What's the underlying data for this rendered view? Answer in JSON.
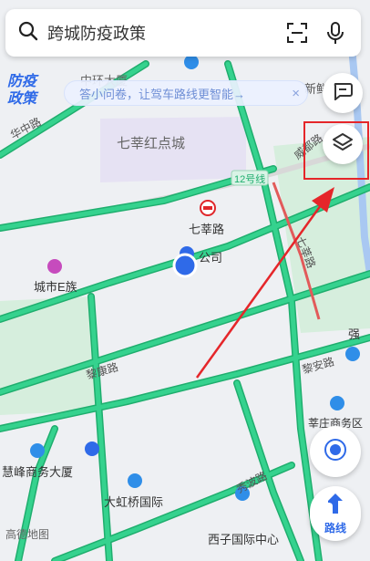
{
  "search": {
    "text": "跨城防疫政策"
  },
  "banner": {
    "text": "答小问卷，让驾车路线更智能→",
    "close": "×"
  },
  "epidemic_logo": {
    "line1": "防疫",
    "line2": "政策"
  },
  "map_labels": {
    "district": "七莘红点城",
    "metro_line": "12号线",
    "metro_station": "七莘路",
    "company": "公司",
    "hotel": "城市E族",
    "road_huazhong": "华中路",
    "road_weidu": "威都路",
    "road_qixin": "七莘路",
    "road_likang": "黎康路",
    "road_jingan": "黎安路",
    "road_xiubo": "秀波路",
    "poi_qiang": "强",
    "poi_xinbei": "莘庄商务区",
    "poi_huifeng": "慧峰商务大厦",
    "poi_dahongqiao": "大虹桥国际",
    "poi_xizi": "西子国际中心",
    "poi_top_left": "中环大厦",
    "poi_top_right": "新鲜"
  },
  "controls": {
    "route_label": "路线"
  },
  "brand": "高德地图",
  "colors": {
    "road": "#35d28e",
    "road_edge": "#1fae6e",
    "accent": "#2f6ae8",
    "highlight": "#e5262a"
  },
  "icons": {
    "search": "search-icon",
    "scan": "scan-icon",
    "mic": "mic-icon",
    "message": "message-icon",
    "layers": "layers-icon",
    "locate": "locate-icon",
    "route": "route-icon"
  }
}
